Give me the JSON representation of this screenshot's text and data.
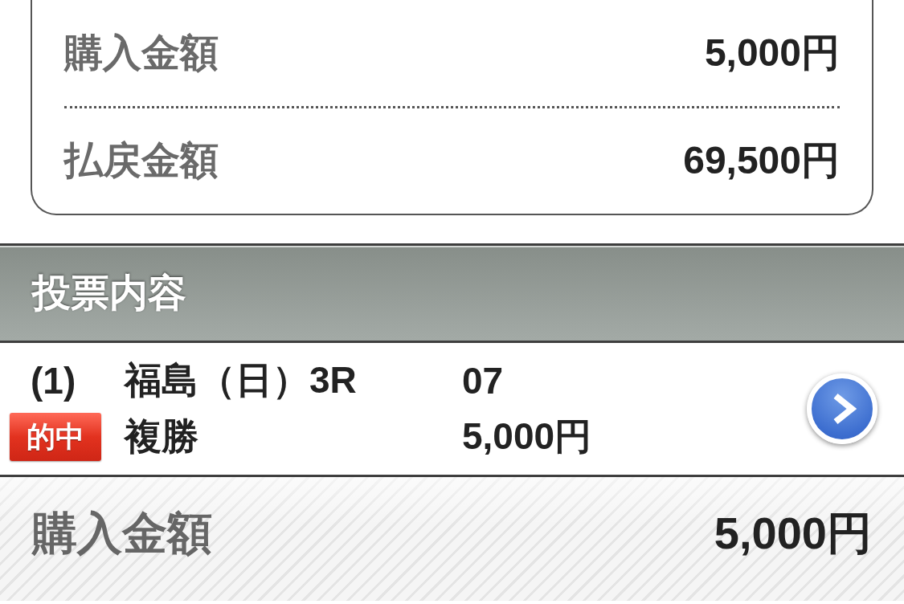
{
  "summary": {
    "rows": [
      {
        "label": "購入金額",
        "value": "5,000円"
      },
      {
        "label": "払戻金額",
        "value": "69,500円"
      }
    ]
  },
  "section": {
    "title": "投票内容"
  },
  "bets": [
    {
      "number": "(1)",
      "race": "福島（日）3R",
      "selection": "07",
      "badge": "的中",
      "bet_type": "複勝",
      "amount": "5,000円"
    }
  ],
  "footer": {
    "label": "購入金額",
    "value": "5,000円"
  }
}
